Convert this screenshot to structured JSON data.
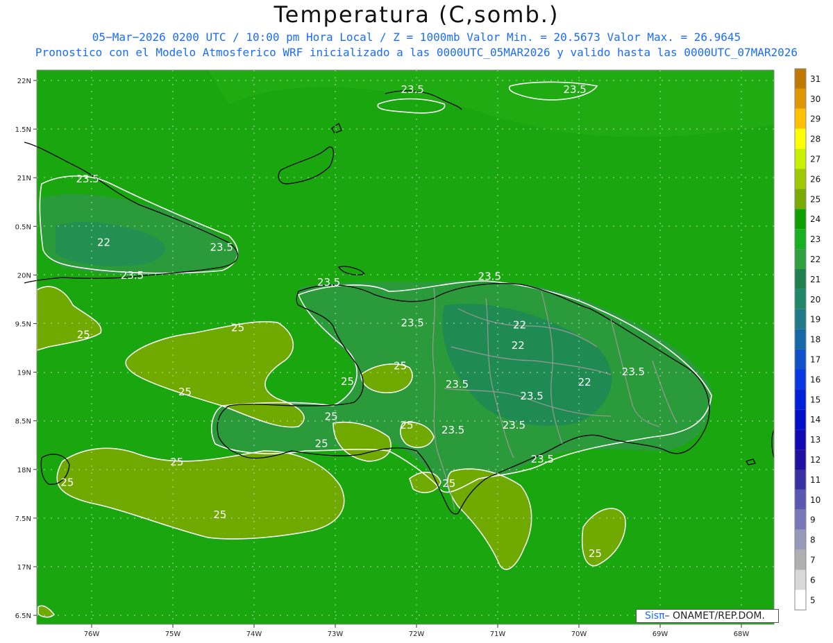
{
  "header": {
    "title": "Temperatura (C,somb.)",
    "subtitle_1": "05−Mar−2026 0200 UTC / 10:00 pm Hora Local / Z = 1000mb   Valor Min. = 20.5673  Valor Max. = 26.9645",
    "subtitle_2": "Pronostico con el Modelo Atmosferico WRF inicializado a las 0000UTC_05MAR2026 y valido hasta las  0000UTC_07MAR2026",
    "subtitle_color": "#1a6cff"
  },
  "map": {
    "region": "Hispaniola / Eastern Cuba / Southern Bahamas",
    "longitude_ticks": [
      "76W",
      "75W",
      "74W",
      "73W",
      "72W",
      "71W",
      "70W",
      "69W",
      "68W"
    ],
    "latitude_ticks": [
      "22N",
      "1.5N",
      "21N",
      "0.5N",
      "20N",
      "9.5N",
      "19N",
      "8.5N",
      "18N",
      "7.5N",
      "17N",
      "6.5N"
    ],
    "grid": "dotted",
    "contour_labels": [
      {
        "text": "23.5",
        "lon": -72.05,
        "lat": 21.87
      },
      {
        "text": "23.5",
        "lon": -70.05,
        "lat": 21.87
      },
      {
        "text": "23.5",
        "lon": -76.05,
        "lat": 20.95
      },
      {
        "text": "22",
        "lon": -75.85,
        "lat": 20.3
      },
      {
        "text": "23.5",
        "lon": -74.4,
        "lat": 20.25
      },
      {
        "text": "23.5",
        "lon": -75.5,
        "lat": 19.96
      },
      {
        "text": "23.5",
        "lon": -73.08,
        "lat": 19.89
      },
      {
        "text": "23.5",
        "lon": -71.1,
        "lat": 19.95
      },
      {
        "text": "23.5",
        "lon": -72.05,
        "lat": 19.47
      },
      {
        "text": "22",
        "lon": -70.73,
        "lat": 19.45
      },
      {
        "text": "22",
        "lon": -70.75,
        "lat": 19.24
      },
      {
        "text": "22",
        "lon": -69.93,
        "lat": 18.86
      },
      {
        "text": "23.5",
        "lon": -69.33,
        "lat": 18.97
      },
      {
        "text": "23.5",
        "lon": -71.5,
        "lat": 18.84
      },
      {
        "text": "23.5",
        "lon": -70.58,
        "lat": 18.72
      },
      {
        "text": "23.5",
        "lon": -70.8,
        "lat": 18.42
      },
      {
        "text": "23.5",
        "lon": -71.55,
        "lat": 18.37
      },
      {
        "text": "23.5",
        "lon": -70.45,
        "lat": 18.07
      },
      {
        "text": "25",
        "lon": -76.1,
        "lat": 19.35
      },
      {
        "text": "25",
        "lon": -74.2,
        "lat": 19.42
      },
      {
        "text": "25",
        "lon": -74.85,
        "lat": 18.76
      },
      {
        "text": "25",
        "lon": -72.85,
        "lat": 18.87
      },
      {
        "text": "25",
        "lon": -72.2,
        "lat": 19.03
      },
      {
        "text": "25",
        "lon": -73.05,
        "lat": 18.51
      },
      {
        "text": "25",
        "lon": -72.12,
        "lat": 18.42
      },
      {
        "text": "25",
        "lon": -73.17,
        "lat": 18.23
      },
      {
        "text": "25",
        "lon": -74.95,
        "lat": 18.04
      },
      {
        "text": "25",
        "lon": -76.3,
        "lat": 17.83
      },
      {
        "text": "25",
        "lon": -74.42,
        "lat": 17.5
      },
      {
        "text": "25",
        "lon": -71.6,
        "lat": 17.82
      },
      {
        "text": "25",
        "lon": -69.8,
        "lat": 17.1
      }
    ]
  },
  "colorbar": {
    "labels": [
      "31",
      "30",
      "29",
      "28",
      "27",
      "26",
      "25",
      "24",
      "23",
      "22",
      "21",
      "20",
      "19",
      "18",
      "17",
      "16",
      "15",
      "14",
      "13",
      "12",
      "11",
      "10",
      "9",
      "8",
      "7",
      "6",
      "5"
    ],
    "colors": [
      "#c07800",
      "#e09600",
      "#ffc000",
      "#ffff00",
      "#c8f000",
      "#a0c800",
      "#78aa00",
      "#0fa000",
      "#18b020",
      "#30a040",
      "#208050",
      "#208868",
      "#207888",
      "#1868a8",
      "#1050c8",
      "#0838e0",
      "#0020d8",
      "#0010c8",
      "#1008b0",
      "#2010a0",
      "#3830a0",
      "#5858b0",
      "#7878b8",
      "#9898b8",
      "#b0b0b0",
      "#d8d8d8",
      "#ffffff"
    ]
  },
  "credit": {
    "sis": "Sis",
    "pi": "π",
    "org": "– ONAMET/REP.DOM."
  },
  "colors": {
    "sea_green": "#19a60f",
    "warm_olive": "#70aa00",
    "land_dark": "#2a9a3a",
    "contour": "#ffffff",
    "coast": "#000000",
    "province": "#999999"
  }
}
